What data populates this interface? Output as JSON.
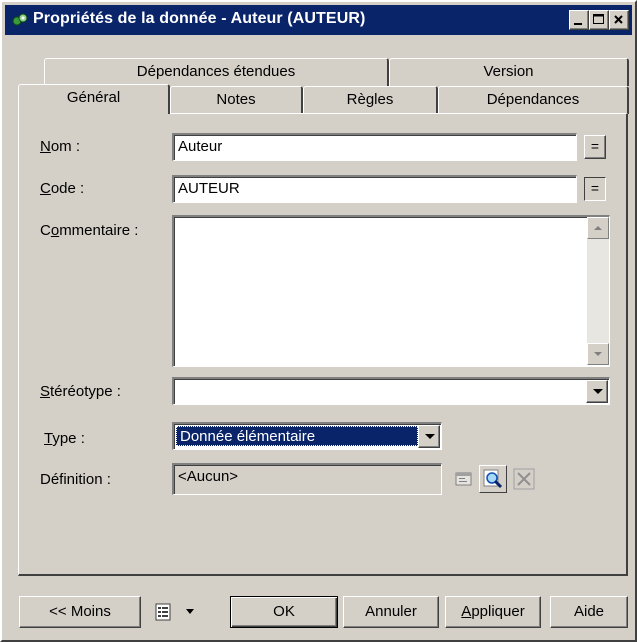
{
  "window": {
    "title": "Propriétés de la donnée - Auteur (AUTEUR)"
  },
  "tabs_row_back": [
    "Dépendances étendues",
    "Version"
  ],
  "tabs_row_front": [
    "Général",
    "Notes",
    "Règles",
    "Dépendances"
  ],
  "active_tab": "Général",
  "form": {
    "name_label_key": "N",
    "name_label_rest": "om :",
    "name_value": "Auteur",
    "code_label_key": "C",
    "code_label_rest": "ode :",
    "code_value": "AUTEUR",
    "comment_label_pre": "C",
    "comment_label_key": "o",
    "comment_label_rest": "mmentaire :",
    "comment_value": "",
    "stereotype_label_key": "S",
    "stereotype_label_rest": "téréotype :",
    "stereotype_value": "",
    "type_label_key": "T",
    "type_label_rest": "ype :",
    "type_value": "Donnée élémentaire",
    "definition_label": "Définition :",
    "definition_value": "<Aucun>",
    "equal_glyph": "="
  },
  "buttons": {
    "less": "<< Moins",
    "ok": "OK",
    "cancel": "Annuler",
    "apply_key": "A",
    "apply_rest": "ppliquer",
    "help": "Aide"
  },
  "colors": {
    "titlebar": "#0a246a",
    "selection": "#0a246a",
    "face": "#d4d0c8"
  }
}
